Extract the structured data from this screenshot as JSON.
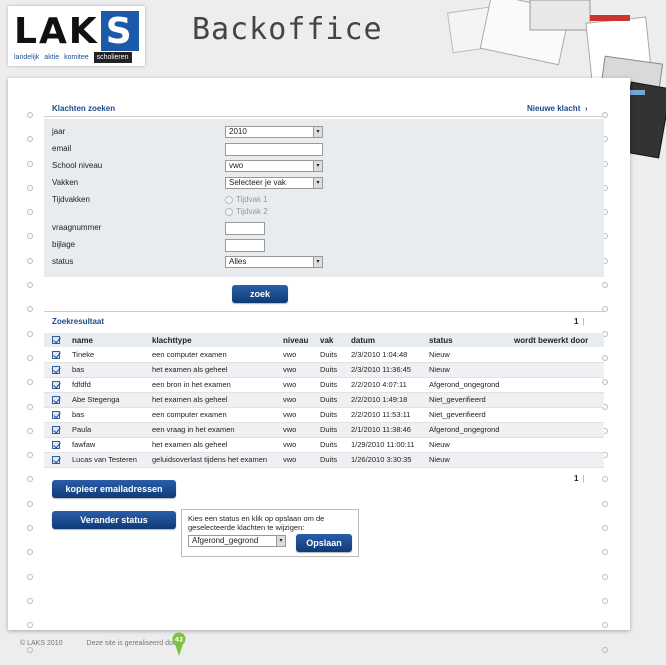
{
  "header": {
    "logo_letters": "LAK",
    "logo_s": "S",
    "logo_nav": [
      "landelijk",
      "aktie",
      "komitee",
      "scholieren"
    ],
    "title": "Backoffice"
  },
  "search": {
    "title": "Klachten zoeken",
    "new_link": "Nieuwe klacht",
    "fields": {
      "jaar_label": "jaar",
      "jaar_value": "2010",
      "email_label": "email",
      "email_value": "",
      "niveau_label": "School niveau",
      "niveau_value": "vwo",
      "vakken_label": "Vakken",
      "vakken_value": "Selecteer je vak",
      "tijdvakken_label": "Tijdvakken",
      "tijdvak1": "Tijdvak 1",
      "tijdvak2": "Tijdvak 2",
      "vraagnummer_label": "vraagnummer",
      "vraagnummer_value": "",
      "bijlage_label": "bijlage",
      "bijlage_value": "",
      "status_label": "status",
      "status_value": "Alles"
    },
    "submit_label": "zoek"
  },
  "results": {
    "title": "Zoekresultaat",
    "page": "1",
    "pager_sep": "|",
    "columns": [
      "name",
      "klachttype",
      "niveau",
      "vak",
      "datum",
      "status",
      "wordt bewerkt door"
    ],
    "rows": [
      {
        "name": "Tineke",
        "type": "een computer examen",
        "niveau": "vwo",
        "vak": "Duits",
        "datum": "2/3/2010 1:04:48",
        "status": "Nieuw",
        "editor": ""
      },
      {
        "name": "bas",
        "type": "het examen als geheel",
        "niveau": "vwo",
        "vak": "Duits",
        "datum": "2/3/2010 11:36:45",
        "status": "Nieuw",
        "editor": ""
      },
      {
        "name": "fdfdfd",
        "type": "een bron in het examen",
        "niveau": "vwo",
        "vak": "Duits",
        "datum": "2/2/2010 4:07:11",
        "status": "Afgerond_ongegrond",
        "editor": ""
      },
      {
        "name": "Abe Stegenga",
        "type": "het examen als geheel",
        "niveau": "vwo",
        "vak": "Duits",
        "datum": "2/2/2010 1:49:18",
        "status": "Niet_geverifieerd",
        "editor": ""
      },
      {
        "name": "bas",
        "type": "een computer examen",
        "niveau": "vwo",
        "vak": "Duits",
        "datum": "2/2/2010 11:53:11",
        "status": "Niet_geverifieerd",
        "editor": ""
      },
      {
        "name": "Paula",
        "type": "een vraag in het examen",
        "niveau": "vwo",
        "vak": "Duits",
        "datum": "2/1/2010 11:38:46",
        "status": "Afgerond_ongegrond",
        "editor": ""
      },
      {
        "name": "fawfaw",
        "type": "het examen als geheel",
        "niveau": "vwo",
        "vak": "Duits",
        "datum": "1/29/2010 11:00:11",
        "status": "Nieuw",
        "editor": ""
      },
      {
        "name": "Lucas van Testeren",
        "type": "geluidsoverlast tijdens het examen",
        "niveau": "vwo",
        "vak": "Duits",
        "datum": "1/26/2010 3:30:35",
        "status": "Nieuw",
        "editor": ""
      }
    ],
    "copy_emails_label": "kopieer emailadressen",
    "change_status_label": "Verander status",
    "status_instructions": "Kies een status en klik op opslaan om de geselecteerde klachten te wijzigen:",
    "status_select_value": "Afgerond_gegrond",
    "save_label": "Opslaan"
  },
  "footer": {
    "copyright": "© LAKS 2010",
    "realized_by": "Deze site is gerealiseerd door",
    "badge_text": "42"
  }
}
